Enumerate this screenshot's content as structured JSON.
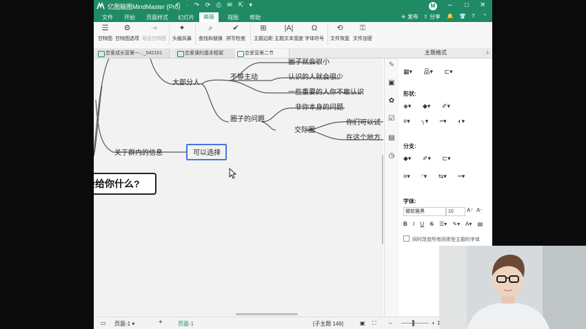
{
  "titlebar": {
    "title": "亿图脑图MindMaster (Pro)",
    "quick_access": "↶ · ↷ ⟳ ⎙ ✉ ⇱ ▾",
    "avatar_letter": "M",
    "publish": "发布",
    "share": "分享"
  },
  "menu": [
    "文件",
    "开始",
    "页面样式",
    "幻灯片",
    "高级",
    "视图",
    "帮助"
  ],
  "menu_active": "高级",
  "ribbon": [
    {
      "label": "甘特图",
      "icon": "gantt-icon",
      "glyph": "☰"
    },
    {
      "label": "甘特图选项",
      "icon": "gantt-options-icon",
      "glyph": "⚙"
    },
    {
      "label": "导出甘特图",
      "icon": "export-gantt-icon",
      "glyph": "⇥"
    },
    {
      "label": "头脑风暴",
      "icon": "lightbulb-icon",
      "glyph": "♀"
    },
    {
      "label": "查找和替换",
      "icon": "find-replace-icon",
      "glyph": "⌕"
    },
    {
      "label": "拼写检查",
      "icon": "spell-check-icon",
      "glyph": "✔"
    },
    {
      "label": "主题边距",
      "icon": "topic-margin-icon",
      "glyph": "⊞"
    },
    {
      "label": "主题文本宽度",
      "icon": "text-width-icon",
      "glyph": "|A|"
    },
    {
      "label": "字体符号",
      "icon": "font-symbol-icon",
      "glyph": "Ω"
    },
    {
      "label": "文件恢复",
      "icon": "file-recovery-icon",
      "glyph": "⟲"
    },
    {
      "label": "文件加密",
      "icon": "file-encrypt-icon",
      "glyph": "🔒"
    }
  ],
  "tabs": [
    "恋爱成长营第一..._042161",
    "恋爱课的基本框架",
    "恋爱营第二节"
  ],
  "tab_active": 2,
  "panel_title": "主题格式",
  "canvas": {
    "central_topic": "会给你什么?",
    "nodes": {
      "majority": "大部分人",
      "not_active": "不够主动",
      "circle_small": "圈子就会很小",
      "know_few": "认识的人就会很少",
      "important_people": "一些重要的人你不敢认识",
      "circle_problem": "圈子的问题",
      "not_yourself": "非你本身的问题",
      "social_circle": "交际圈",
      "can_try": "你们可以试",
      "here": "在这个地方",
      "group_info": "关于群内的信息",
      "can_choose": "可以选择"
    }
  },
  "panel": {
    "shape_label": "形状:",
    "branch_label": "分支:",
    "font_label": "字体:",
    "font_name": "微软雅黑",
    "font_size": "10",
    "checkbox_label": "同时改变所有同类型主题的字体"
  },
  "status": {
    "page_dropdown": "页面-1",
    "page_tab": "页面-1",
    "add_page": "+",
    "subtopic_count": "[子主题 146]",
    "zoom": "1"
  }
}
